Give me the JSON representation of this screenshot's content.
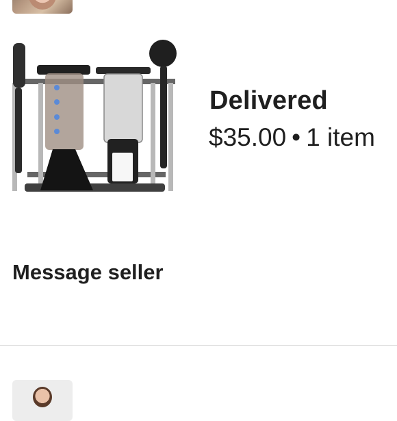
{
  "order": {
    "status": "Delivered",
    "price": "$35.00",
    "separator": "•",
    "items": "1 item",
    "message_seller": "Message seller"
  },
  "icons": {
    "top_thumbnail": "seller-avatar",
    "product_image": "aeropress-coffee-maker-image",
    "bottom_thumbnail": "seller-avatar"
  }
}
